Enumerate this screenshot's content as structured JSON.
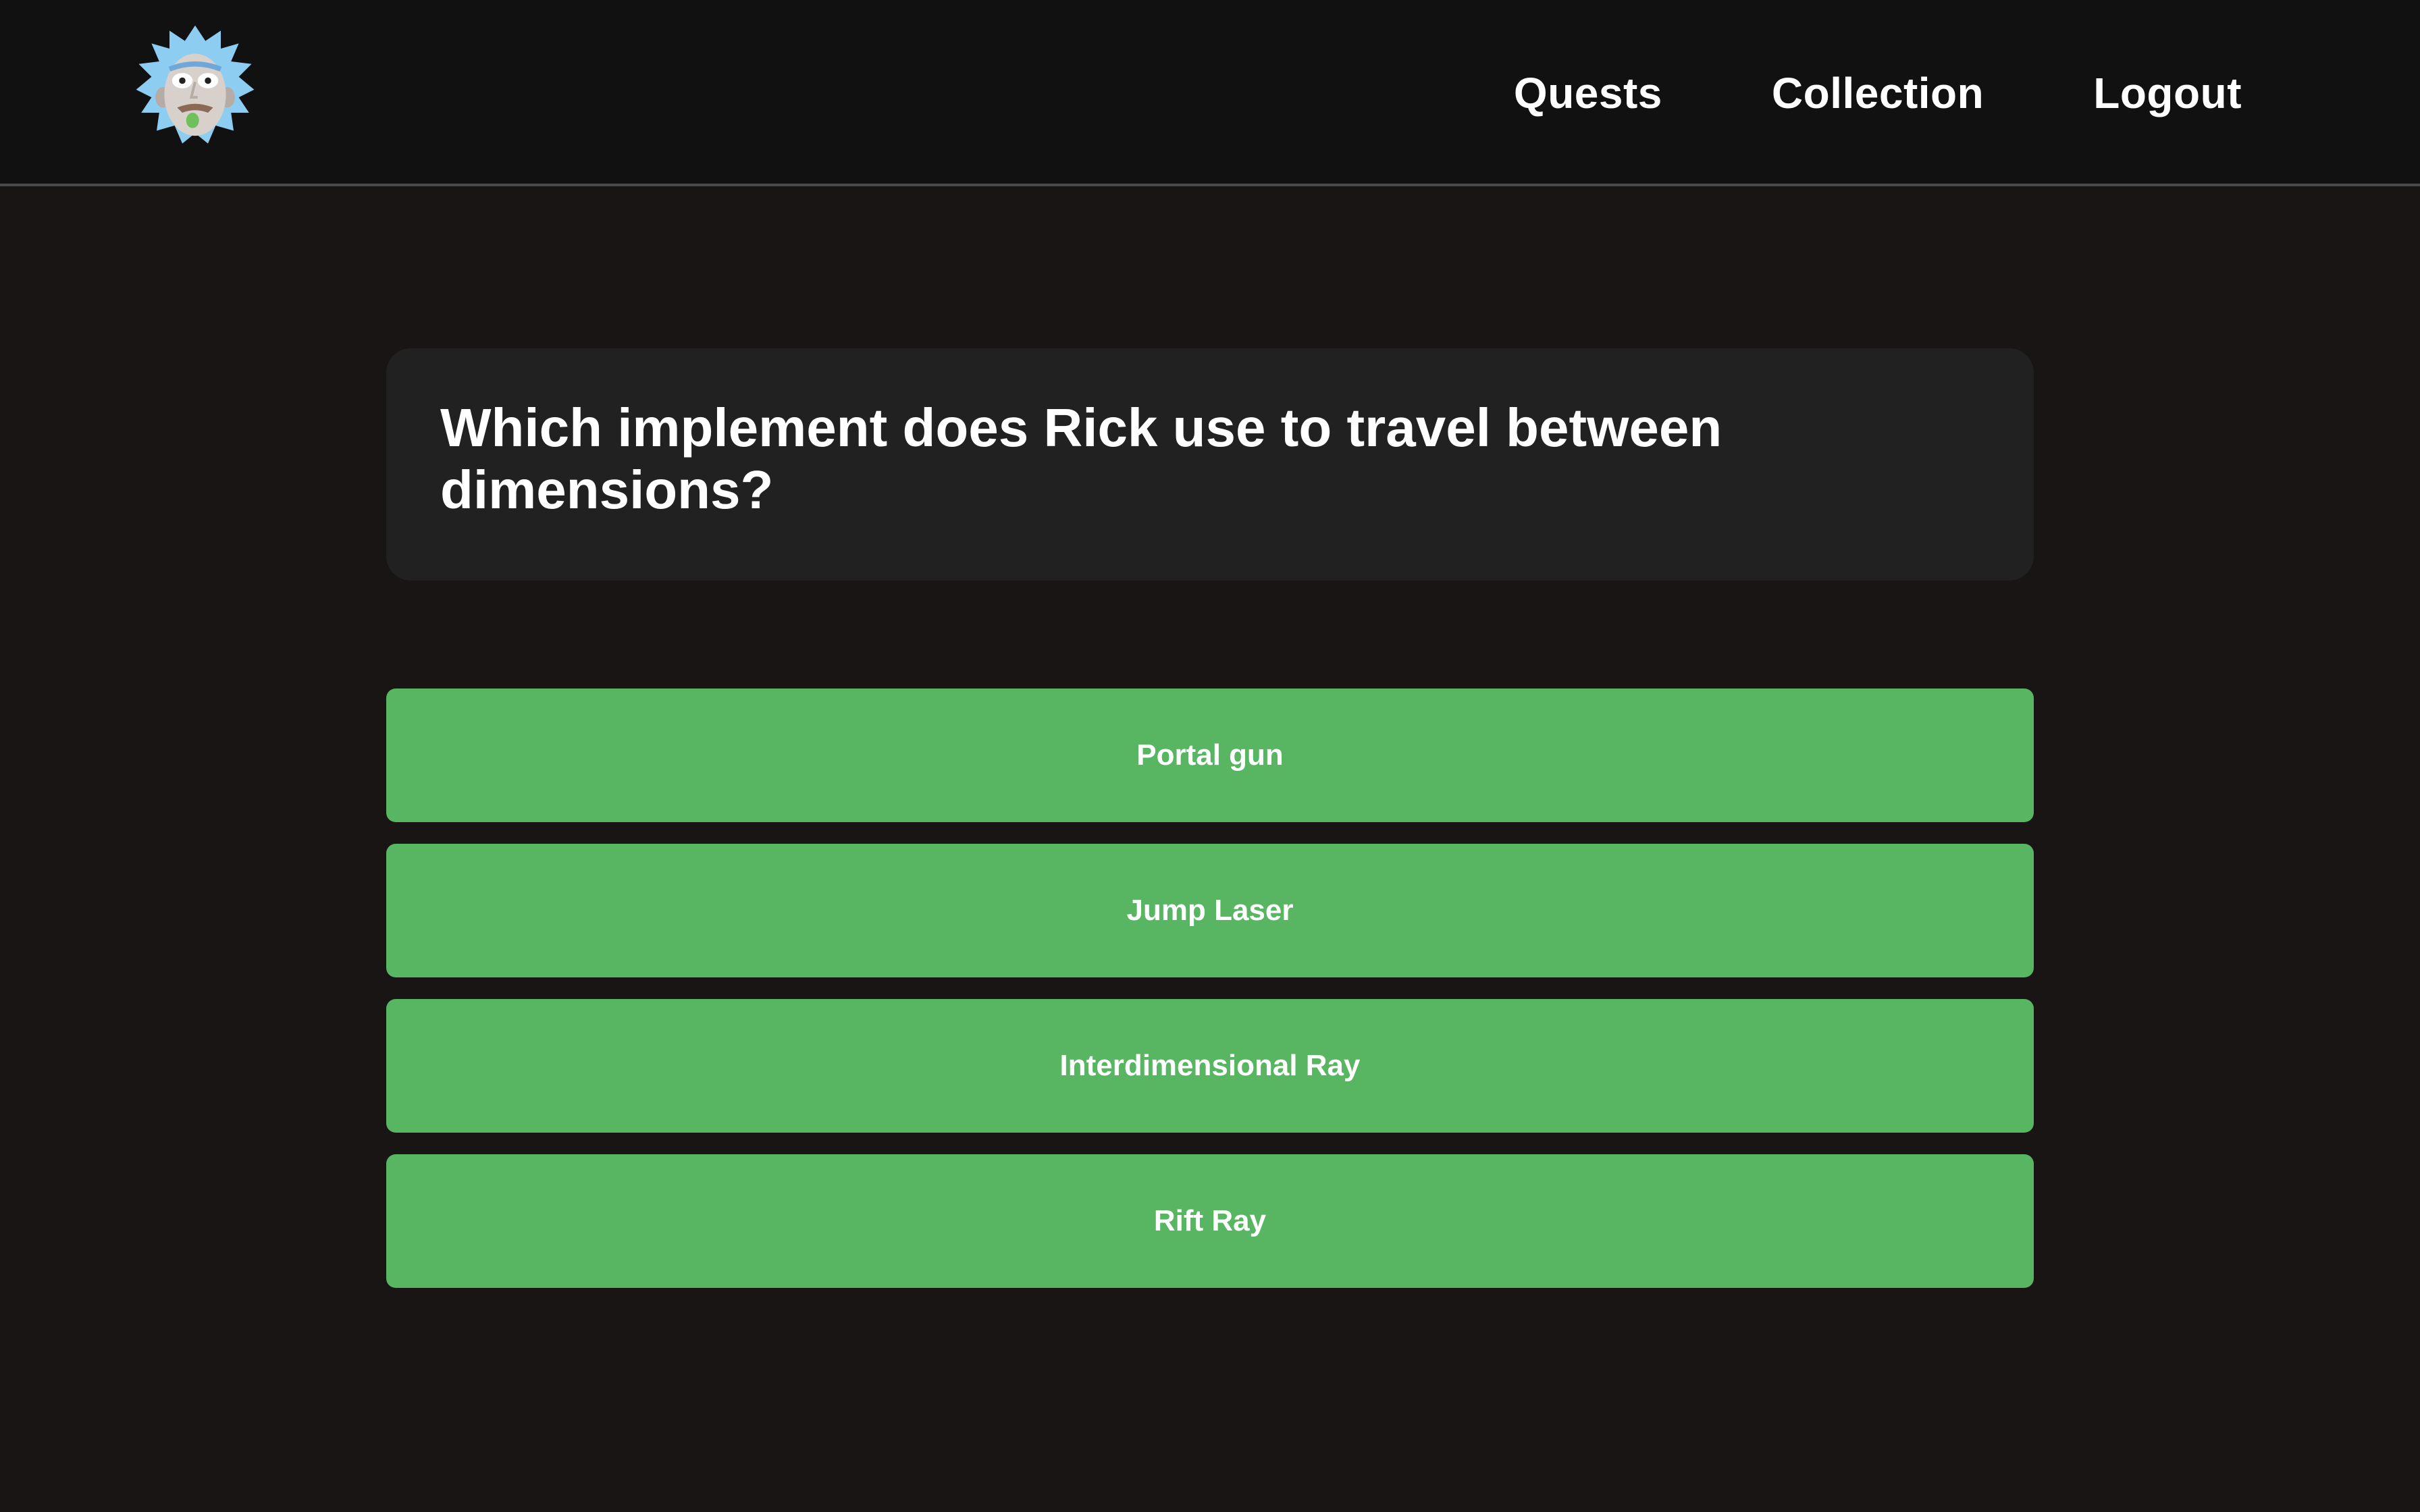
{
  "header": {
    "logo_icon": "rick-face-icon",
    "nav": [
      {
        "label": "Quests"
      },
      {
        "label": "Collection"
      },
      {
        "label": "Logout"
      }
    ]
  },
  "quiz": {
    "question": "Which implement does Rick use to travel between dimensions?",
    "answers": [
      {
        "label": "Portal gun"
      },
      {
        "label": "Jump Laser"
      },
      {
        "label": "Interdimensional Ray"
      },
      {
        "label": "Rift Ray"
      }
    ]
  },
  "colors": {
    "background": "#181514",
    "navbar": "#111112",
    "card": "#212121",
    "answer_button": "#58b562",
    "text": "#ffffff"
  }
}
